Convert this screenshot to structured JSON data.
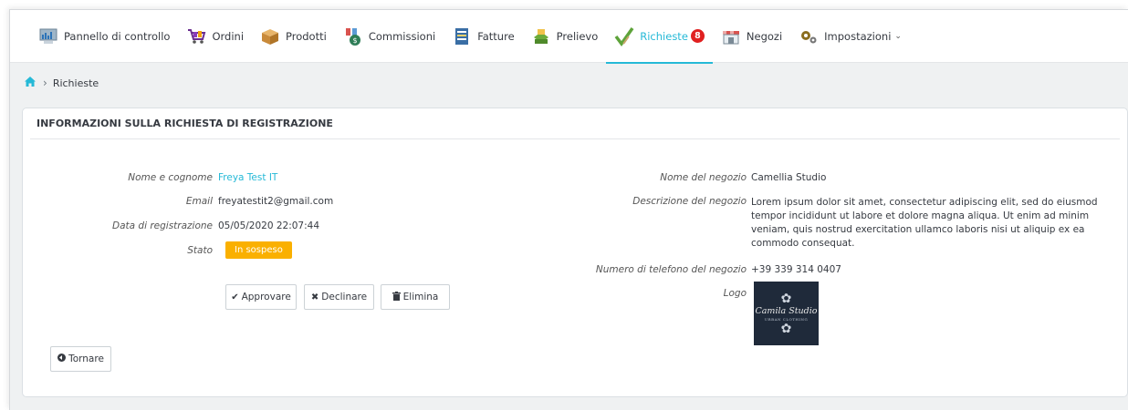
{
  "nav": {
    "items": [
      {
        "label": "Pannello di controllo",
        "icon": "dashboard-icon"
      },
      {
        "label": "Ordini",
        "icon": "cart-icon"
      },
      {
        "label": "Prodotti",
        "icon": "box-icon"
      },
      {
        "label": "Commissioni",
        "icon": "money-bag-icon"
      },
      {
        "label": "Fatture",
        "icon": "invoice-icon"
      },
      {
        "label": "Prelievo",
        "icon": "withdraw-icon"
      },
      {
        "label": "Richieste",
        "icon": "check-request-icon",
        "badge": "8"
      },
      {
        "label": "Negozi",
        "icon": "shop-icon"
      },
      {
        "label": "Impostazioni",
        "icon": "gears-icon"
      }
    ],
    "active": "Richieste",
    "accent": "#25b9d7"
  },
  "breadcrumb": {
    "current": "Richieste"
  },
  "panel": {
    "title": "INFORMAZIONI SULLA RICHIESTA DI REGISTRAZIONE",
    "left": {
      "name_label": "Nome e cognome",
      "name_value": "Freya Test IT",
      "email_label": "Email",
      "email_value": "freyatestit2@gmail.com",
      "date_label": "Data di registrazione",
      "date_value": "05/05/2020 22:07:44",
      "status_label": "Stato",
      "status_value": "In sospeso",
      "status_color": "#fab000"
    },
    "right": {
      "shop_label": "Nome del negozio",
      "shop_value": "Camellia Studio",
      "desc_label": "Descrizione del negozio",
      "desc_value": "Lorem ipsum dolor sit amet, consectetur adipiscing elit, sed do eiusmod tempor incididunt ut labore et dolore magna aliqua. Ut enim ad minim veniam, quis nostrud exercitation ullamco laboris nisi ut aliquip ex ea commodo consequat.",
      "phone_label": "Numero di telefono del negozio",
      "phone_value": "+39 339 314 0407",
      "logo_label": "Logo",
      "logo_text": "Camila Studio",
      "logo_subtext": "URBAN CLOTHING"
    },
    "buttons": {
      "approve": "Approvare",
      "decline": "Declinare",
      "delete": "Elimina",
      "back": "Tornare"
    }
  }
}
